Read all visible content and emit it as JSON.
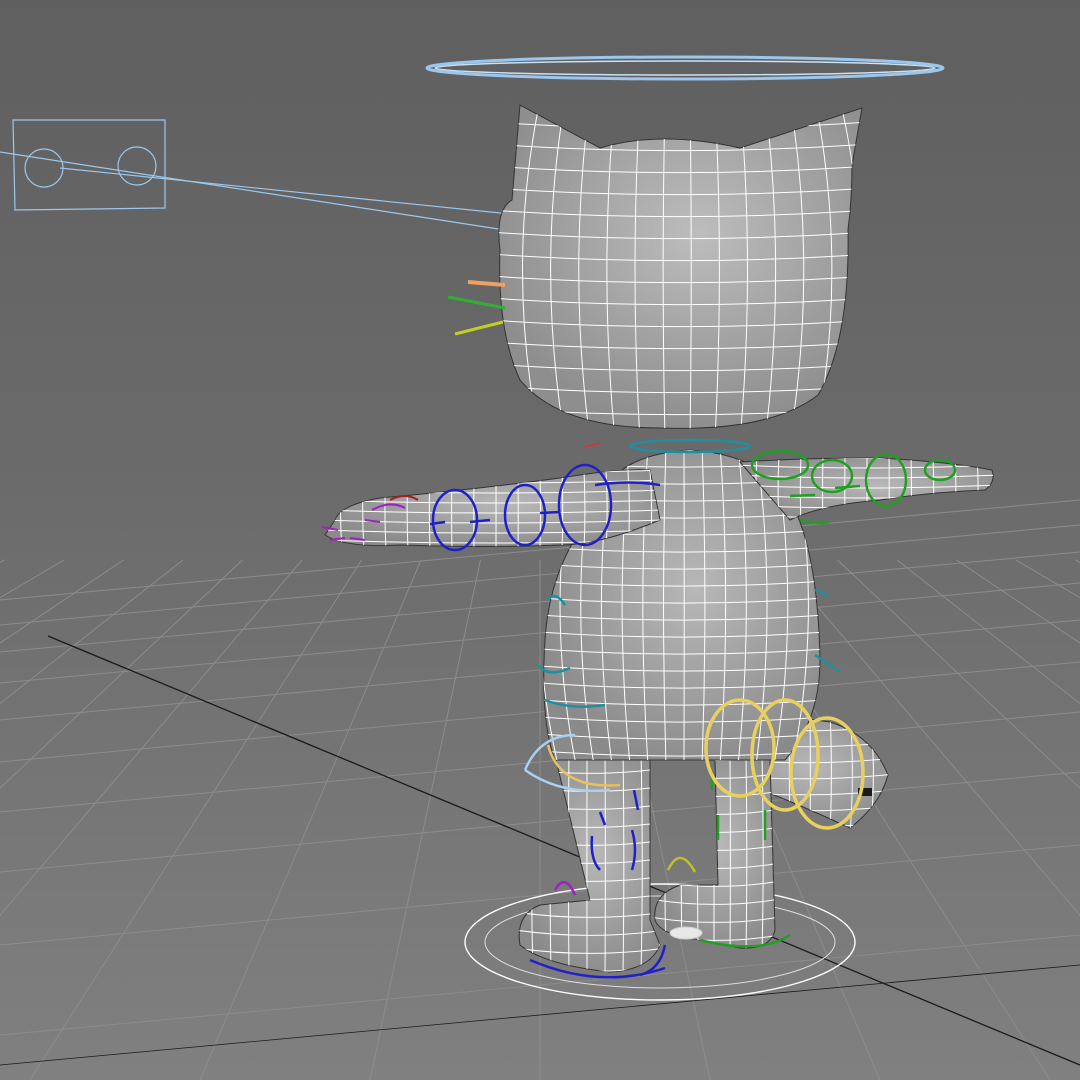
{
  "viewport": {
    "kind": "3d-perspective-viewport",
    "background_top": "#5f5f5f",
    "background_bottom": "#808080"
  },
  "scene": {
    "model": "cartoon-cat-character",
    "pose": "T-pose",
    "display_mode": "edged-faces",
    "colors": {
      "mesh_fill": "#a6a6a6",
      "mesh_wire": "#ffffff",
      "grid_line": "#8c8c8c",
      "grid_axis": "#1a1a1a",
      "halo_control": "#9bc7ee",
      "spine_control": "#1f8fa0",
      "left_arm_control": "#2020c8",
      "right_arm_control": "#20a020",
      "finger_control": "#a020c0",
      "tail_control": "#e8d060",
      "knee_control": "#a8d0f0",
      "root_control": "#ffffff",
      "whisker_orange": "#f0a060",
      "whisker_green": "#30b030",
      "whisker_yellow": "#c0d020",
      "eye_control_frame": "#9bc7ee"
    },
    "controls": [
      "head-halo-control",
      "eye-look-control",
      "spine-controls",
      "arm-controls",
      "finger-controls",
      "tail-controls",
      "leg-controls",
      "foot-controls",
      "root-control"
    ]
  }
}
